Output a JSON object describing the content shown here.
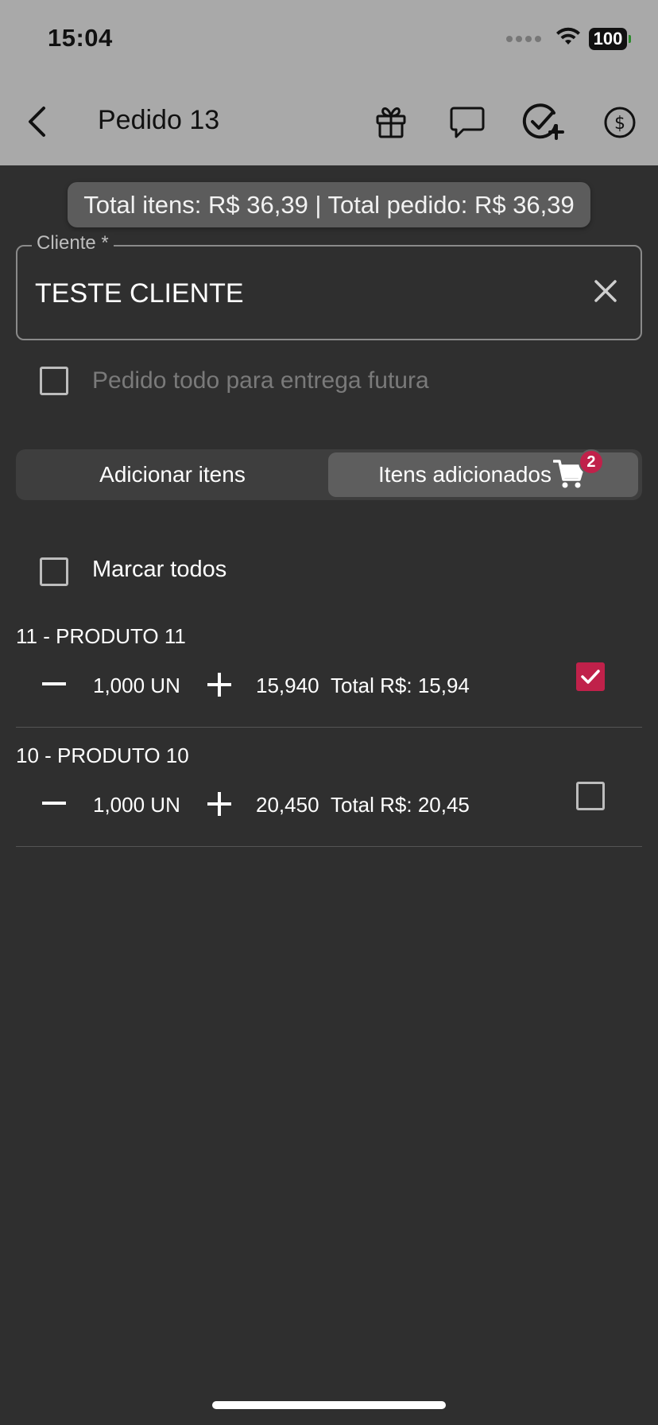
{
  "status_bar": {
    "time": "15:04",
    "battery": "100"
  },
  "header": {
    "title": "Pedido 13"
  },
  "totals": {
    "text": "Total itens: R$ 36,39 | Total pedido: R$ 36,39"
  },
  "cliente": {
    "label": "Cliente *",
    "value": "TESTE CLIENTE"
  },
  "future_delivery": {
    "label": "Pedido todo para entrega futura",
    "checked": false
  },
  "tabs": {
    "add_label": "Adicionar itens",
    "added_label": "Itens adicionados",
    "cart_count": "2"
  },
  "select_all": {
    "label": "Marcar todos",
    "checked": false
  },
  "products": [
    {
      "name": "11 - PRODUTO 11",
      "qty": "1,000 UN",
      "price": "15,940",
      "total": "Total R$: 15,94",
      "checked": true
    },
    {
      "name": "10 - PRODUTO 10",
      "qty": "1,000 UN",
      "price": "20,450",
      "total": "Total R$: 20,45",
      "checked": false
    }
  ],
  "colors": {
    "header_bg": "#a9a9a9",
    "page_bg": "#2f2f2f",
    "accent": "#c0214a"
  }
}
